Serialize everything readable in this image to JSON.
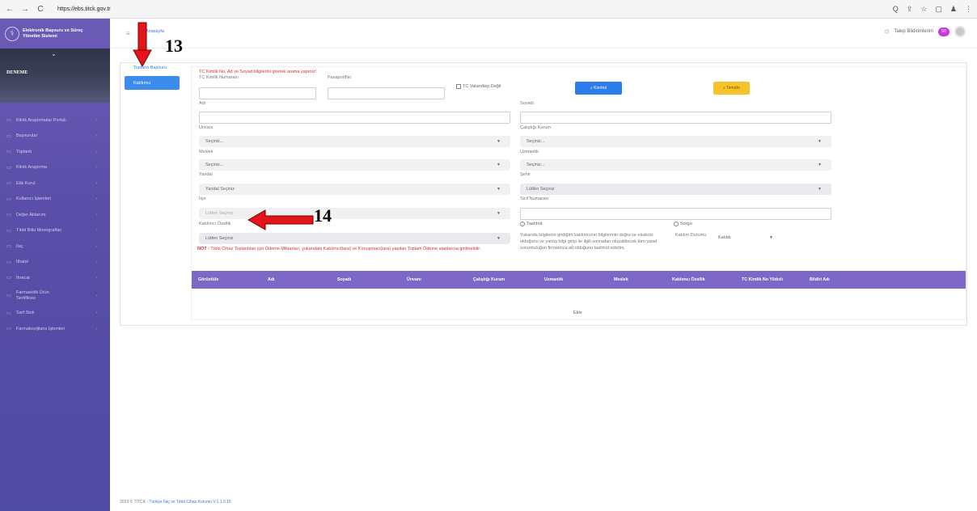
{
  "browser": {
    "back": "←",
    "forward": "→",
    "reload": "C",
    "url": "https://ebs.titck.gov.tr",
    "icons": [
      "zoom-icon",
      "share-icon",
      "star-icon",
      "tab-icon",
      "profile-icon",
      "menu-icon"
    ],
    "right_glyphs": [
      "Q",
      "⇪",
      "☆",
      "▢",
      "♟",
      "⋮"
    ]
  },
  "sidebar": {
    "brand_line1": "Elektronik Başvuru ve Süreç",
    "brand_line2": "Yönetim Sistemi",
    "user_name": "DENEME",
    "items": [
      {
        "label": "Klinik Araştırmalar Portalı"
      },
      {
        "label": "Başvurular"
      },
      {
        "label": "Toplantı"
      },
      {
        "label": "Klinik Araştırma"
      },
      {
        "label": "Etik Kurul"
      },
      {
        "label": "Kullanıcı İşlemleri"
      },
      {
        "label": "Değer Aktarımı"
      },
      {
        "label": "Tıbbi Bitki Monografları"
      },
      {
        "label": "İlaç"
      },
      {
        "label": "İthalat"
      },
      {
        "label": "İhracat"
      },
      {
        "label": "Farmasötik Ürün Sertifikası"
      },
      {
        "label": "Sarf Stok"
      },
      {
        "label": "Farmakovijilans İşlemleri"
      }
    ],
    "arrow_glyph": "›"
  },
  "topbar": {
    "breadcrumb": "Anasayfa",
    "requests": "Talep Bildirimlerim",
    "notif_count": "50"
  },
  "tabs": {
    "top": "Toplantı Başvuru",
    "active": "Katılımcı"
  },
  "form": {
    "warning": "TC Kimlik No, Ad ve Soyad bilgilerini girerek arama yapınız!",
    "tc_label": "TC Kimlik Numarası",
    "passport_label": "PasaportNo",
    "not_citizen": "TC Vatandaşı Değil",
    "control_btn": "Kontrol",
    "clear_btn": "Temizle",
    "name_label": "Adı",
    "surname_label": "Soyadı",
    "title_label": "Ünvanı",
    "title_value": "Seçiniz...",
    "institution_label": "Çalıştığı Kurum",
    "institution_value": "Seçiniz...",
    "profession_label": "Meslek",
    "profession_value": "Seçiniz...",
    "specialty_label": "Uzmanlık",
    "specialty_value": "Seçiniz...",
    "sponsor_label": "Yandal",
    "sponsor_value": "Yandal Seçiniz",
    "city_label": "Şehir",
    "city_value": "Lütfen Seçiniz",
    "district_label": "İlçe",
    "district_value": "Lütfen Seçiniz",
    "registry_label": "Sicil Numarası",
    "participant_feature_label": "Katılımcı Özellik",
    "participant_feature_value": "Lütfen Seçiniz",
    "commitment_label": "Taahhüt",
    "query_label": "Sorgu",
    "commitment_text": "Yukarıda bilgilerini girdiğim katılımcının bilgilerinin doğru ve eksiksiz olduğunu ve yanlış bilgi girişi ile ilgili sonradan oluşabilecek tüm yasal sorumluluğun firmamıza ait olduğunu taahhüt ederim.",
    "participation_status_label": "Katılım Durumu",
    "participation_status_value": "Katıldı",
    "notice_prefix": "NOT :",
    "notice_text": " Tıbbi Cihaz Toplantıları için Ödeme Miktarları, yukarıdaki Katılımcı(lara) ve Konuşmacı(lara) yapılan Toplam Ödeme alanlarına girilmelidir."
  },
  "table": {
    "headers": [
      "Görüntüle",
      "Adı",
      "Soyadı",
      "Ünvanı",
      "Çalıştığı Kurum",
      "Uzmanlık",
      "Meslek",
      "Katılımcı Özellik",
      "TC Kimlik No Yildızlı",
      "Bildiri Adı"
    ]
  },
  "add_link": "Ekle",
  "footer": {
    "prefix": "2023 © TİTCK -",
    "link": "Türkiye İlaç ve Tıbbi Cihaz Kurumu V.1.1.0.15"
  },
  "annotations": {
    "label_13": "13",
    "label_14": "14",
    "arrow_color": "#e3151a"
  },
  "colors": {
    "sidebar": "#5a4ea8",
    "primary": "#3b8ced",
    "warning_text": "#d9302c",
    "table_header": "#7d68c8",
    "clear_button": "#f7c32c"
  }
}
